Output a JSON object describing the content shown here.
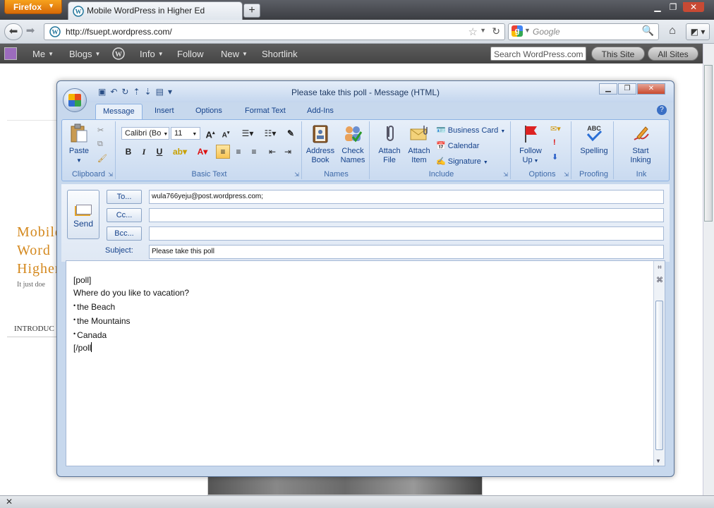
{
  "browser": {
    "menu_label": "Firefox",
    "tab_title": "Mobile WordPress in Higher Ed",
    "new_tab": "+",
    "url": "http://fsuept.wordpress.com/",
    "search_placeholder": "Google"
  },
  "wpbar": {
    "items": [
      {
        "label": "Me",
        "dropdown": true
      },
      {
        "label": "Blogs",
        "dropdown": true
      },
      {
        "label": "Info",
        "dropdown": true
      },
      {
        "label": "Follow",
        "dropdown": false
      },
      {
        "label": "New",
        "dropdown": true
      },
      {
        "label": "Shortlink",
        "dropdown": false
      }
    ],
    "search_placeholder": "Search WordPress.com",
    "this_site": "This Site",
    "all_sites": "All Sites"
  },
  "blog": {
    "title_line1": "Mobile",
    "title_line2": "Word",
    "title_line3": "Higher",
    "tagline": "It just doe",
    "nav_intro": "INTRODUC"
  },
  "outlook": {
    "title": "Please take this poll - Message (HTML)",
    "tabs": [
      "Message",
      "Insert",
      "Options",
      "Format Text",
      "Add-Ins"
    ],
    "ribbon": {
      "paste": "Paste",
      "clipboard": "Clipboard",
      "font_name": "Calibri (Bo",
      "font_size": "11",
      "basic_text": "Basic Text",
      "address_book_1": "Address",
      "address_book_2": "Book",
      "check_names_1": "Check",
      "check_names_2": "Names",
      "names": "Names",
      "attach_file_1": "Attach",
      "attach_file_2": "File",
      "attach_item_1": "Attach",
      "attach_item_2": "Item",
      "business_card": "Business Card",
      "calendar": "Calendar",
      "signature": "Signature",
      "include": "Include",
      "follow_up_1": "Follow",
      "follow_up_2": "Up",
      "options": "Options",
      "spelling": "Spelling",
      "proofing": "Proofing",
      "start_inking_1": "Start",
      "start_inking_2": "Inking",
      "ink": "Ink"
    },
    "form": {
      "send": "Send",
      "to_label": "To...",
      "cc_label": "Cc...",
      "bcc_label": "Bcc...",
      "subject_label": "Subject:",
      "to_value": "wula766yeju@post.wordpress.com;",
      "cc_value": "",
      "bcc_value": "",
      "subject_value": "Please take this poll"
    },
    "body": {
      "line1": "[poll]",
      "line2": "Where do you like to vacation?",
      "opt1": "the Beach",
      "opt2": "the Mountains",
      "opt3": "Canada",
      "line_end": "[/poll"
    }
  }
}
